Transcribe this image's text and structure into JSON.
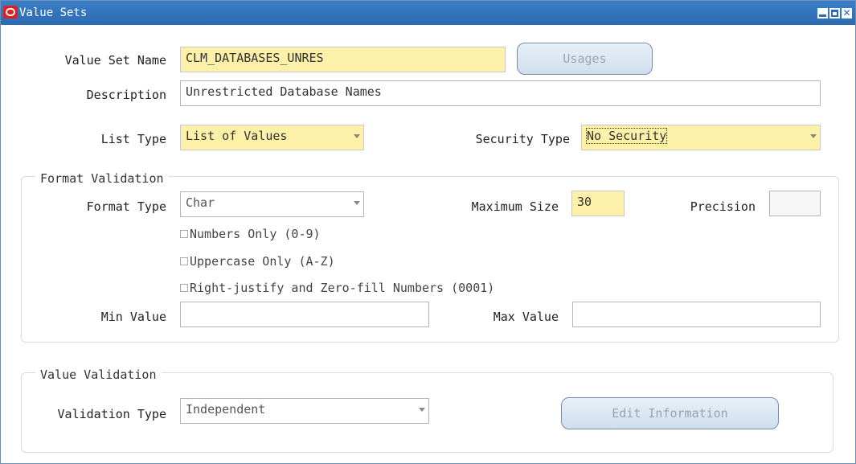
{
  "window": {
    "title": "Value Sets",
    "title_bar_color": "#2b6bb2",
    "logo_color": "#e02020",
    "close_glyph": "✕"
  },
  "header": {
    "value_set_name_label": "Value Set Name",
    "value_set_name_value": "CLM_DATABASES_UNRES",
    "usages_label": "Usages",
    "description_label": "Description",
    "description_value": "Unrestricted Database Names",
    "list_type_label": "List Type",
    "list_type_value": "List of Values",
    "security_type_label": "Security Type",
    "security_type_value": "No Security"
  },
  "format_validation": {
    "title": "Format Validation",
    "format_type_label": "Format Type",
    "format_type_value": "Char",
    "maximum_size_label": "Maximum Size",
    "maximum_size_value": "30",
    "precision_label": "Precision",
    "precision_value": "",
    "numbers_only_label": "Numbers Only (0-9)",
    "uppercase_only_label": "Uppercase Only (A-Z)",
    "right_justify_label": "Right-justify and Zero-fill Numbers (0001)",
    "min_value_label": "Min Value",
    "min_value_value": "",
    "max_value_label": "Max Value",
    "max_value_value": ""
  },
  "value_validation": {
    "title": "Value Validation",
    "validation_type_label": "Validation Type",
    "validation_type_value": "Independent",
    "edit_information_label": "Edit Information"
  },
  "colors": {
    "required_field": "#fdf0a8",
    "button_text_disabled": "#9aa3ad"
  }
}
